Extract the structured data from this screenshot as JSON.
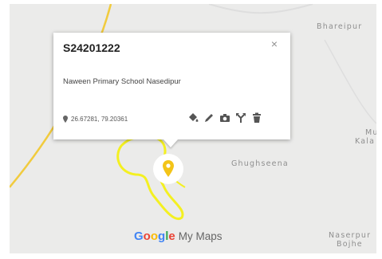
{
  "map": {
    "places": {
      "bhareipur": "Bhareipur",
      "ghughseena": "Ghughseena",
      "mu": "Mu",
      "kala": "Kala",
      "naserpur": "Naserpur",
      "bojhe": "Bojhe"
    },
    "colors": {
      "background": "#ebebea",
      "road": "#f1cb3e",
      "boundary": "#f4f021",
      "marker": "#f3c418"
    }
  },
  "popup": {
    "title": "S24201222",
    "close_symbol": "×",
    "description": "Naween Primary School Nasedipur",
    "coordinates": "26.67281, 79.20361",
    "actions": [
      "paint-bucket-icon",
      "pencil-icon",
      "camera-icon",
      "directions-icon",
      "trash-icon"
    ]
  },
  "branding": {
    "google_letters": [
      "G",
      "o",
      "o",
      "g",
      "l",
      "e"
    ],
    "google_colors": [
      "#4285f4",
      "#ea4335",
      "#fbbc05",
      "#4285f4",
      "#34a853",
      "#ea4335"
    ],
    "product": "My Maps"
  }
}
